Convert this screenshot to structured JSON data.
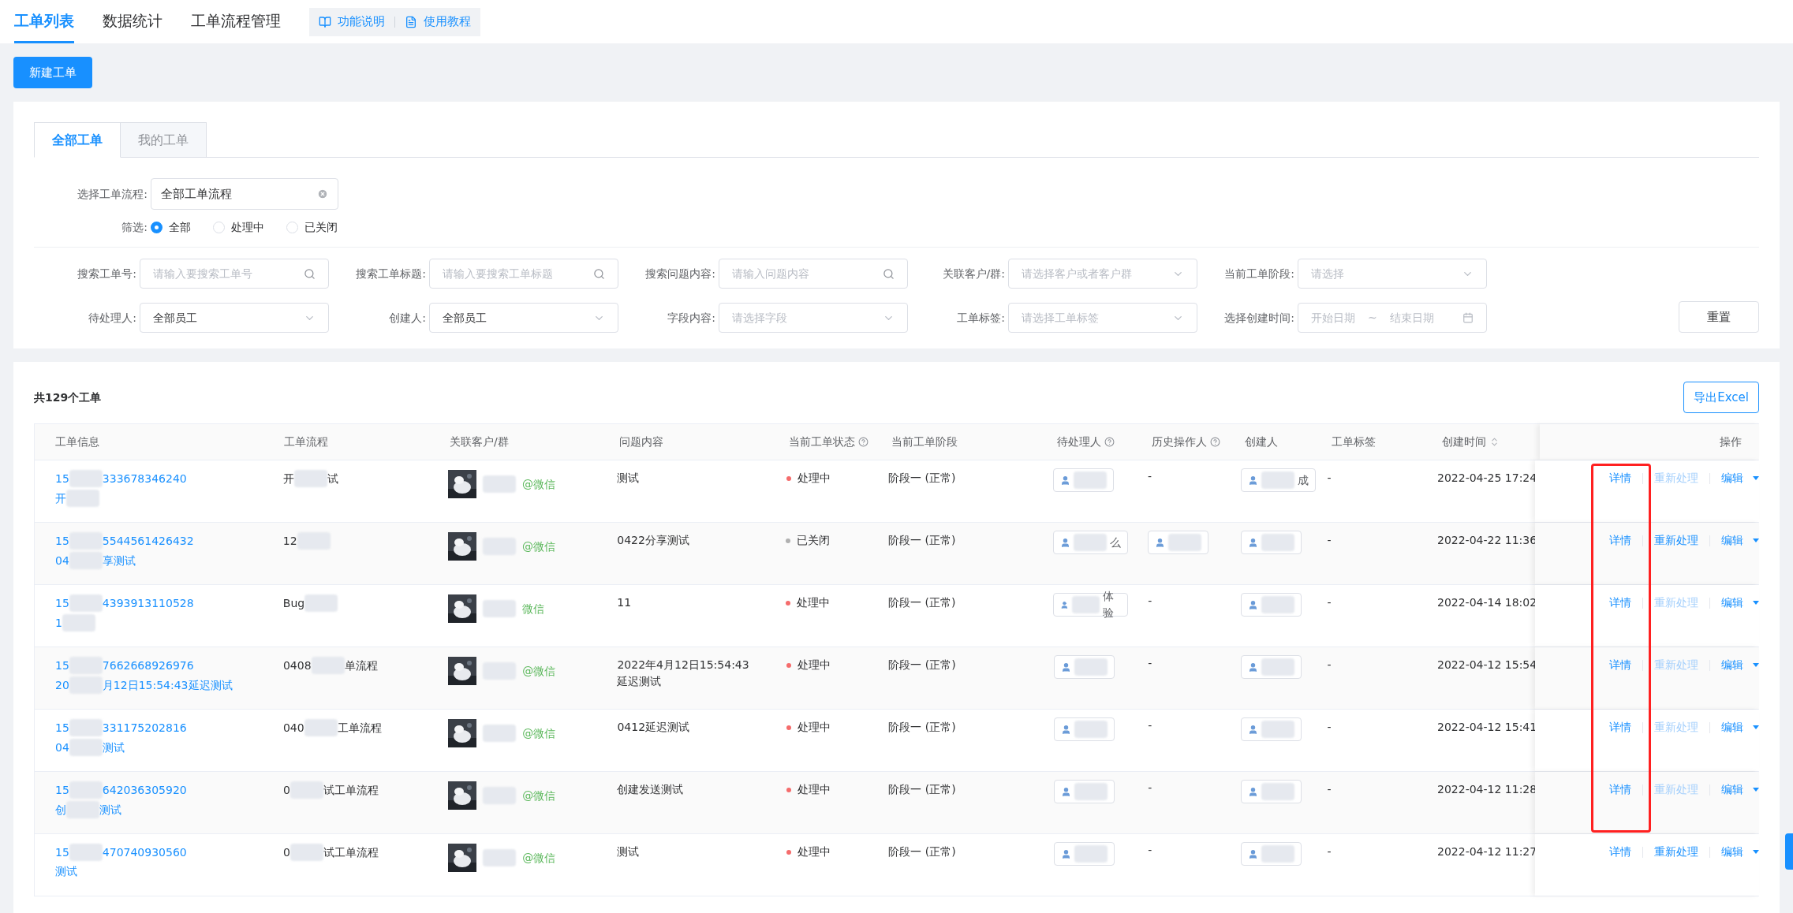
{
  "nav": {
    "tabs": [
      {
        "label": "工单列表",
        "selected": true
      },
      {
        "label": "数据统计",
        "selected": false
      },
      {
        "label": "工单流程管理",
        "selected": false
      }
    ],
    "links": [
      {
        "kind": "book",
        "label": "功能说明"
      },
      {
        "kind": "doc",
        "label": "使用教程"
      }
    ]
  },
  "new_button": "新建工单",
  "list_tabs": [
    {
      "label": "全部工单",
      "selected": true
    },
    {
      "label": "我的工单",
      "selected": false
    }
  ],
  "flow_select": {
    "label": "选择工单流程:",
    "value": "全部工单流程"
  },
  "status_filter": {
    "label": "筛选:",
    "options": [
      {
        "label": "全部",
        "selected": true
      },
      {
        "label": "处理中",
        "selected": false
      },
      {
        "label": "已关闭",
        "selected": false
      }
    ]
  },
  "filters": [
    {
      "kind": "search",
      "label": "搜索工单号:",
      "placeholder": "请输入要搜索工单号"
    },
    {
      "kind": "search",
      "label": "搜索工单标题:",
      "placeholder": "请输入要搜索工单标题"
    },
    {
      "kind": "search",
      "label": "搜索问题内容:",
      "placeholder": "请输入问题内容"
    },
    {
      "kind": "select",
      "label": "关联客户/群:",
      "placeholder": "请选择客户或者客户群"
    },
    {
      "kind": "select",
      "label": "当前工单阶段:",
      "placeholder": "请选择"
    },
    {
      "kind": "select",
      "label": "待处理人:",
      "value": "全部员工"
    },
    {
      "kind": "select",
      "label": "创建人:",
      "value": "全部员工"
    },
    {
      "kind": "select",
      "label": "字段内容:",
      "placeholder": "请选择字段"
    },
    {
      "kind": "select",
      "label": "工单标签:",
      "placeholder": "请选择工单标签"
    },
    {
      "kind": "date",
      "label": "选择创建时间:",
      "start": "开始日期",
      "sep": "~",
      "end": "结束日期"
    }
  ],
  "reset_button": "重置",
  "count": "共129个工单",
  "export_button": "导出Excel",
  "table": {
    "columns": [
      {
        "label": "工单信息",
        "help": false,
        "sort": false
      },
      {
        "label": "工单流程",
        "help": false,
        "sort": false
      },
      {
        "label": "关联客户/群",
        "help": false,
        "sort": false
      },
      {
        "label": "问题内容",
        "help": false,
        "sort": false
      },
      {
        "label": "当前工单状态",
        "help": true,
        "sort": false
      },
      {
        "label": "当前工单阶段",
        "help": false,
        "sort": false
      },
      {
        "label": "待处理人",
        "help": true,
        "sort": false
      },
      {
        "label": "历史操作人",
        "help": true,
        "sort": false
      },
      {
        "label": "创建人",
        "help": false,
        "sort": false
      },
      {
        "label": "工单标签",
        "help": false,
        "sort": false
      },
      {
        "label": "创建时间",
        "help": false,
        "sort": true
      },
      {
        "label": "操作",
        "help": false,
        "sort": false
      }
    ],
    "rows": [
      {
        "ticket_no": [
          {
            "text": "15"
          },
          {
            "kind": "redacted"
          },
          {
            "text": "333678346240"
          }
        ],
        "title": [
          {
            "text": "开"
          },
          {
            "kind": "redacted"
          }
        ],
        "flow": [
          {
            "text": "开"
          },
          {
            "kind": "redacted"
          },
          {
            "text": "试"
          }
        ],
        "customer": [
          {
            "kind": "redacted"
          },
          {
            "text": "@微信"
          }
        ],
        "issue": "测试",
        "status": {
          "text": "处理中",
          "color": "#f56c6c"
        },
        "stage": "阶段一 (正常)",
        "pending": [
          {
            "kind": "redacted"
          }
        ],
        "history": {
          "kind": "dash",
          "text": "-"
        },
        "creator": [
          {
            "kind": "redacted"
          },
          {
            "text": "成"
          }
        ],
        "tag": "-",
        "created": "2022-04-25 17:24",
        "actions": [
          {
            "label": "详情",
            "disabled": false
          },
          {
            "label": "重新处理",
            "disabled": true
          },
          {
            "label": "编辑",
            "disabled": false
          }
        ]
      },
      {
        "ticket_no": [
          {
            "text": "15"
          },
          {
            "kind": "redacted"
          },
          {
            "text": "5544561426432"
          }
        ],
        "title": [
          {
            "text": "04"
          },
          {
            "kind": "redacted"
          },
          {
            "text": "享测试"
          }
        ],
        "flow": [
          {
            "text": "12"
          },
          {
            "kind": "redacted"
          }
        ],
        "customer": [
          {
            "kind": "redacted"
          },
          {
            "text": "@微信"
          }
        ],
        "issue": "0422分享测试",
        "status": {
          "text": "已关闭",
          "color": "#b0b0b0"
        },
        "stage": "阶段一 (正常)",
        "pending": [
          {
            "kind": "redacted"
          },
          {
            "text": "么"
          }
        ],
        "history": {
          "kind": "chip",
          "segments": [
            {
              "kind": "redacted"
            }
          ]
        },
        "creator": [
          {
            "kind": "redacted"
          }
        ],
        "tag": "-",
        "created": "2022-04-22 11:36",
        "actions": [
          {
            "label": "详情",
            "disabled": false
          },
          {
            "label": "重新处理",
            "disabled": false
          },
          {
            "label": "编辑",
            "disabled": false
          }
        ]
      },
      {
        "ticket_no": [
          {
            "text": "15"
          },
          {
            "kind": "redacted"
          },
          {
            "text": "4393913110528"
          }
        ],
        "title": [
          {
            "text": "1"
          },
          {
            "kind": "redacted"
          }
        ],
        "flow": [
          {
            "text": "Bug"
          },
          {
            "kind": "redacted"
          }
        ],
        "customer": [
          {
            "kind": "redacted"
          },
          {
            "text": "微信"
          }
        ],
        "issue": "11",
        "status": {
          "text": "处理中",
          "color": "#f56c6c"
        },
        "stage": "阶段一 (正常)",
        "pending": [
          {
            "kind": "redacted"
          },
          {
            "text": "体验"
          }
        ],
        "history": {
          "kind": "dash",
          "text": "-"
        },
        "creator": [
          {
            "kind": "redacted"
          }
        ],
        "tag": "-",
        "created": "2022-04-14 18:02",
        "actions": [
          {
            "label": "详情",
            "disabled": false
          },
          {
            "label": "重新处理",
            "disabled": true
          },
          {
            "label": "编辑",
            "disabled": false
          }
        ]
      },
      {
        "ticket_no": [
          {
            "text": "15"
          },
          {
            "kind": "redacted"
          },
          {
            "text": "7662668926976"
          }
        ],
        "title": [
          {
            "text": "20"
          },
          {
            "kind": "redacted"
          },
          {
            "text": "月12日15:54:43延迟测试"
          }
        ],
        "flow": [
          {
            "text": "0408"
          },
          {
            "kind": "redacted"
          },
          {
            "text": "单流程"
          }
        ],
        "customer": [
          {
            "kind": "redacted"
          },
          {
            "text": "@微信"
          }
        ],
        "issue": "2022年4月12日15:54:43延迟测试",
        "status": {
          "text": "处理中",
          "color": "#f56c6c"
        },
        "stage": "阶段一 (正常)",
        "pending": [
          {
            "kind": "redacted"
          }
        ],
        "history": {
          "kind": "dash",
          "text": "-"
        },
        "creator": [
          {
            "kind": "redacted"
          }
        ],
        "tag": "-",
        "created": "2022-04-12 15:54",
        "actions": [
          {
            "label": "详情",
            "disabled": false
          },
          {
            "label": "重新处理",
            "disabled": true
          },
          {
            "label": "编辑",
            "disabled": false
          }
        ]
      },
      {
        "ticket_no": [
          {
            "text": "15"
          },
          {
            "kind": "redacted"
          },
          {
            "text": "331175202816"
          }
        ],
        "title": [
          {
            "text": "04"
          },
          {
            "kind": "redacted"
          },
          {
            "text": "测试"
          }
        ],
        "flow": [
          {
            "text": "040"
          },
          {
            "kind": "redacted"
          },
          {
            "text": "工单流程"
          }
        ],
        "customer": [
          {
            "kind": "redacted"
          },
          {
            "text": "@微信"
          }
        ],
        "issue": "0412延迟测试",
        "status": {
          "text": "处理中",
          "color": "#f56c6c"
        },
        "stage": "阶段一 (正常)",
        "pending": [
          {
            "kind": "redacted"
          }
        ],
        "history": {
          "kind": "dash",
          "text": "-"
        },
        "creator": [
          {
            "kind": "redacted"
          }
        ],
        "tag": "-",
        "created": "2022-04-12 15:41",
        "actions": [
          {
            "label": "详情",
            "disabled": false
          },
          {
            "label": "重新处理",
            "disabled": true
          },
          {
            "label": "编辑",
            "disabled": false
          }
        ]
      },
      {
        "ticket_no": [
          {
            "text": "15"
          },
          {
            "kind": "redacted"
          },
          {
            "text": "642036305920"
          }
        ],
        "title": [
          {
            "text": "创"
          },
          {
            "kind": "redacted"
          },
          {
            "text": "测试"
          }
        ],
        "flow": [
          {
            "text": "0"
          },
          {
            "kind": "redacted"
          },
          {
            "text": "试工单流程"
          }
        ],
        "customer": [
          {
            "kind": "redacted"
          },
          {
            "text": "@微信"
          }
        ],
        "issue": "创建发送测试",
        "status": {
          "text": "处理中",
          "color": "#f56c6c"
        },
        "stage": "阶段一 (正常)",
        "pending": [
          {
            "kind": "redacted"
          }
        ],
        "history": {
          "kind": "dash",
          "text": "-"
        },
        "creator": [
          {
            "kind": "redacted"
          }
        ],
        "tag": "-",
        "created": "2022-04-12 11:28",
        "actions": [
          {
            "label": "详情",
            "disabled": false
          },
          {
            "label": "重新处理",
            "disabled": true
          },
          {
            "label": "编辑",
            "disabled": false
          }
        ]
      },
      {
        "ticket_no": [
          {
            "text": "15"
          },
          {
            "kind": "redacted"
          },
          {
            "text": "470740930560"
          }
        ],
        "title": [
          {
            "text": "测试"
          }
        ],
        "flow": [
          {
            "text": "0"
          },
          {
            "kind": "redacted"
          },
          {
            "text": "试工单流程"
          }
        ],
        "customer": [
          {
            "kind": "redacted"
          },
          {
            "text": "@微信"
          }
        ],
        "issue": "测试",
        "status": {
          "text": "处理中",
          "color": "#f56c6c"
        },
        "stage": "阶段一 (正常)",
        "pending": [
          {
            "kind": "redacted"
          }
        ],
        "history": {
          "kind": "dash",
          "text": "-"
        },
        "creator": [
          {
            "kind": "redacted"
          }
        ],
        "tag": "-",
        "created": "2022-04-12 11:27",
        "actions": [
          {
            "label": "详情",
            "disabled": false
          },
          {
            "label": "重新处理",
            "disabled": false
          },
          {
            "label": "编辑",
            "disabled": false
          }
        ]
      }
    ]
  }
}
